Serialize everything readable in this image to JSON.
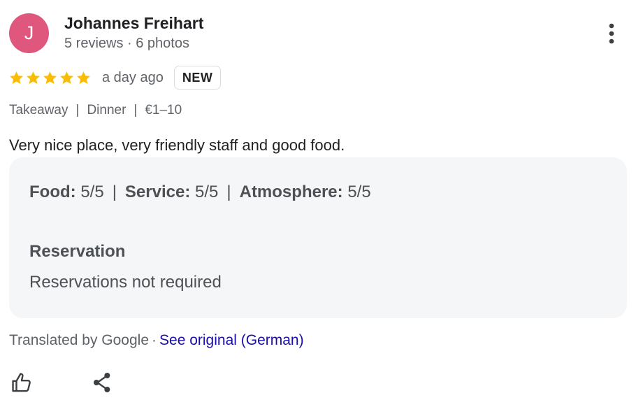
{
  "reviewer": {
    "initial": "J",
    "name": "Johannes Freihart",
    "meta": "5 reviews · 6 photos",
    "avatar_color": "#e0577e"
  },
  "review": {
    "rating": 5,
    "rating_max": 5,
    "star_color": "#fbbc04",
    "date": "a day ago",
    "badge": "NEW",
    "tags": [
      "Takeaway",
      "Dinner",
      "€1–10"
    ],
    "tag_separator": "|",
    "text": "Very nice place, very friendly staff and good food."
  },
  "details": {
    "ratings": [
      {
        "label": "Food:",
        "value": "5/5"
      },
      {
        "label": "Service:",
        "value": "5/5"
      },
      {
        "label": "Atmosphere:",
        "value": "5/5"
      }
    ],
    "ratings_separator": "|",
    "reservation_title": "Reservation",
    "reservation_value": "Reservations not required"
  },
  "translation": {
    "label": "Translated by Google",
    "dot": "·",
    "link": "See original (German)",
    "link_color": "#1a0dab"
  },
  "actions": {
    "more_icon": "more-vertical-icon",
    "like_icon": "thumbs-up-icon",
    "share_icon": "share-icon"
  }
}
